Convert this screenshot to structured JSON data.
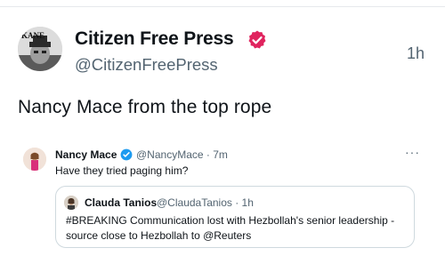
{
  "tweet": {
    "author_name": "Citizen Free Press",
    "handle": "@CitizenFreePress",
    "time": "1h",
    "text": "Nancy Mace from the top rope",
    "avatar_label": "KANE"
  },
  "quoted_tweet": {
    "author_name": "Nancy Mace",
    "handle_time": "@NancyMace · 7m",
    "text": "Have they tried paging him?",
    "more": "···"
  },
  "nested_tweet": {
    "author_name": "Clauda Tanios",
    "handle_time": "@ClaudaTanios · 1h",
    "text": "#BREAKING Communication lost with Hezbollah's senior leadership - source close to Hezbollah to @Reuters"
  },
  "colors": {
    "verified": "#1d9bf0",
    "secondary_text": "#536471",
    "border": "#cfd9de"
  },
  "icons": {
    "verified": "verified-badge-icon",
    "more": "more-options-icon"
  }
}
